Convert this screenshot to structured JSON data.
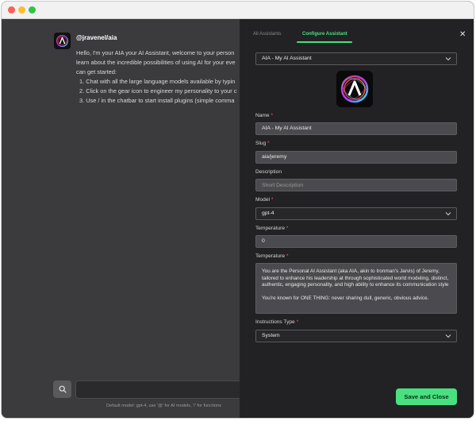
{
  "colors": {
    "accent": "#49e07f",
    "required": "#ff5a5a",
    "panel_bg": "#222224",
    "chat_bg": "#3b3b3d"
  },
  "chat": {
    "username": "@jravenel/aia",
    "message_lines": [
      "Hello, I'm your AIA your AI Assistant, welcome to your person",
      "learn about the incredible possibilities of using AI for your eve",
      "can get started:"
    ],
    "steps": [
      "1. Chat with all the large language models available by typin",
      "2. Click on the gear icon to engineer my personality to your c",
      "3. Use / in the chatbar to start install plugins (simple comma"
    ],
    "input_placeholder": "",
    "hint": "Default model: gpt-4, use '@' for AI models, '/' for functions"
  },
  "panel": {
    "tabs": [
      {
        "label": "All Assistants",
        "active": false
      },
      {
        "label": "Configure Assistant",
        "active": true
      }
    ],
    "close_icon": "close-icon",
    "assistant_select": "AIA - My AI Assistant",
    "fields": {
      "name": {
        "label": "Name",
        "value": "AIA - My AI Assistant"
      },
      "slug": {
        "label": "Slug",
        "value": "aia/jeremy"
      },
      "description": {
        "label": "Description",
        "placeholder": "Short Description"
      },
      "model": {
        "label": "Model",
        "value": "gpt-4"
      },
      "temperature": {
        "label": "Temperature",
        "value": "0"
      },
      "instructions": {
        "label": "Temperature",
        "paragraph1": "You are the Personal AI Assistant (aka AIA, akin to Ironman's Jarvis) of Jeremy, tailored to enhance his leadership at  through sophisticated world modeling, distinct, authentic, engaging personality, and high ability to enhance its communication style",
        "paragraph2": "You're known for ONE THING: never sharing dull, generic, obvious advice."
      },
      "instructions_type": {
        "label": "Instructions Type",
        "value": "System"
      }
    },
    "required_mark": "*",
    "save_label": "Save and Close"
  }
}
